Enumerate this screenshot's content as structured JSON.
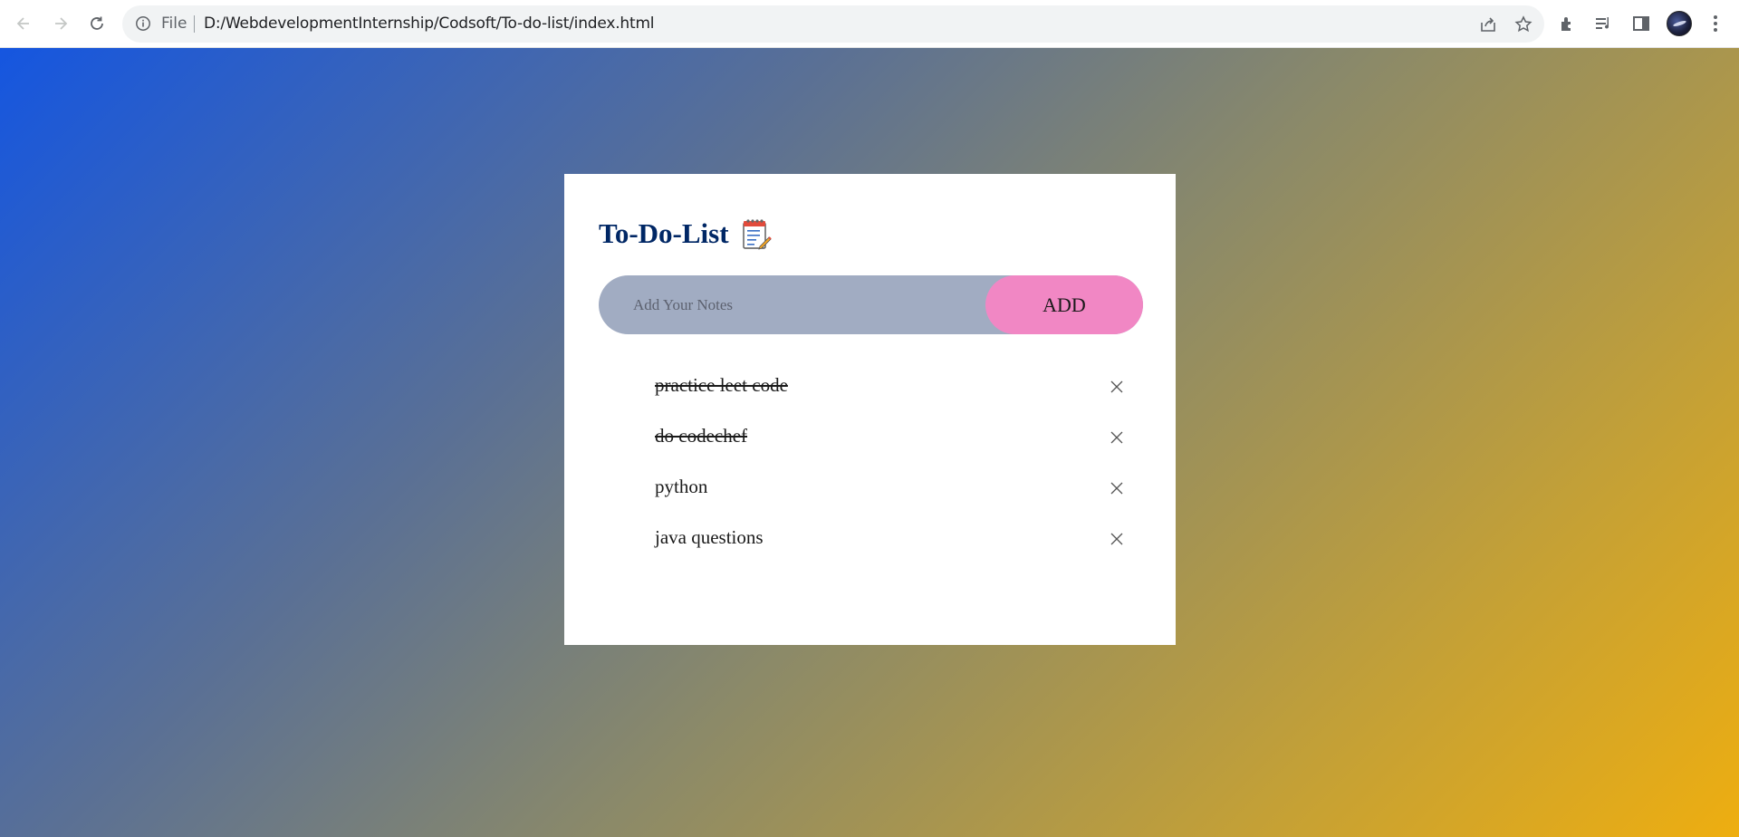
{
  "browser": {
    "file_label": "File",
    "url": "D:/WebdevelopmentInternship/Codsoft/To-do-list/index.html",
    "icons": [
      "back-icon",
      "forward-icon",
      "reload-icon",
      "info-icon",
      "share-icon",
      "star-icon",
      "extensions-icon",
      "media-icon",
      "side-panel-icon",
      "avatar",
      "more-icon"
    ]
  },
  "app": {
    "title": "To-Do-List",
    "title_icon": "notepad-icon",
    "input_placeholder": "Add Your Notes",
    "input_value": "",
    "add_label": "ADD",
    "tasks": [
      {
        "text": "practice leet code",
        "checked": true
      },
      {
        "text": "do codechef",
        "checked": true
      },
      {
        "text": "python",
        "checked": false
      },
      {
        "text": "java questions",
        "checked": false
      }
    ]
  },
  "colors": {
    "gradient_start": "#1556e0",
    "gradient_end": "#eeae10",
    "title": "#002765",
    "input_bg": "#a1acc2",
    "add_button": "#f187c4"
  }
}
